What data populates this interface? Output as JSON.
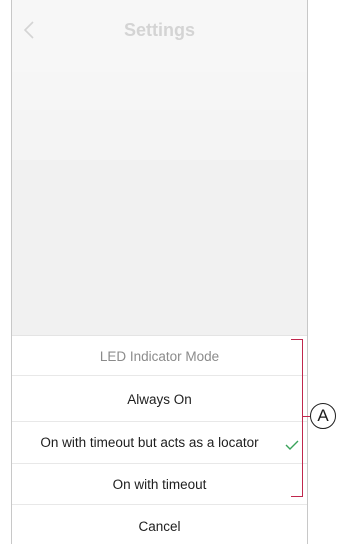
{
  "nav": {
    "title": "Settings",
    "back_icon": "chevron-left-icon"
  },
  "sheet": {
    "header": "LED Indicator Mode",
    "options": [
      {
        "label": "Always On",
        "selected": false
      },
      {
        "label": "On with timeout but acts as a locator",
        "selected": true
      },
      {
        "label": "On with timeout",
        "selected": false
      }
    ],
    "cancel_label": "Cancel"
  },
  "annotation": {
    "callout_label": "A",
    "color": "#c0274d"
  },
  "colors": {
    "check": "#3aa35a",
    "title": "#d4d4d4"
  }
}
